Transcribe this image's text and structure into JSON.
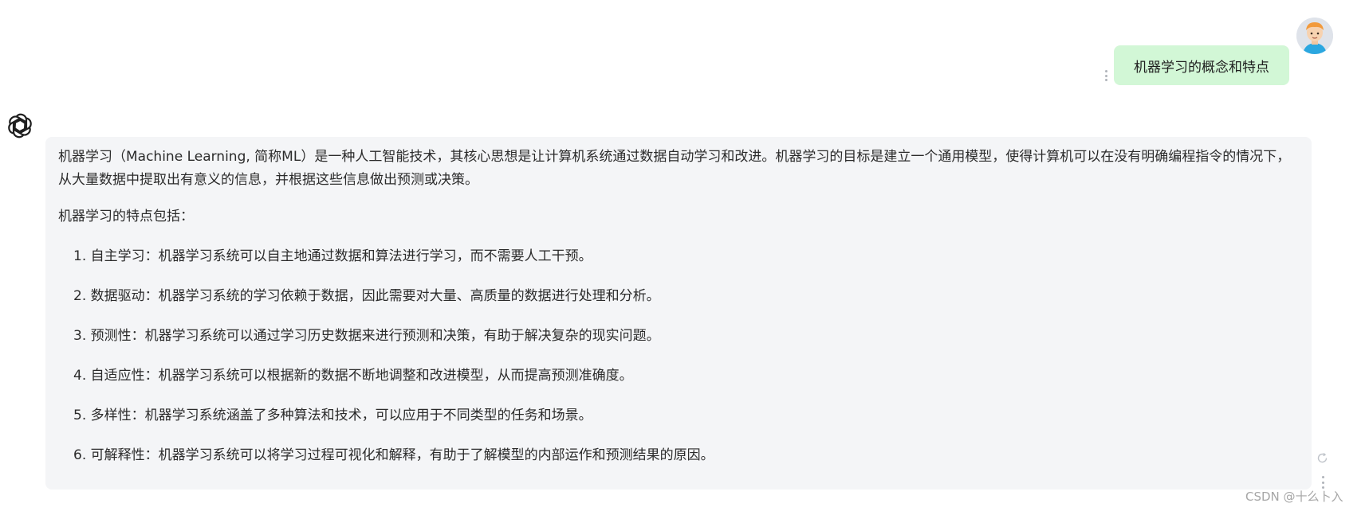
{
  "user_message": {
    "text": "机器学习的概念和特点",
    "avatar_icon": "user-avatar-cartoon"
  },
  "assistant": {
    "logo_icon": "openai-logo-icon",
    "intro": "机器学习（Machine Learning, 简称ML）是一种人工智能技术，其核心思想是让计算机系统通过数据自动学习和改进。机器学习的目标是建立一个通用模型，使得计算机可以在没有明确编程指令的情况下，从大量数据中提取出有意义的信息，并根据这些信息做出预测或决策。",
    "features_heading": "机器学习的特点包括：",
    "features": [
      "1. 自主学习：机器学习系统可以自主地通过数据和算法进行学习，而不需要人工干预。",
      "2. 数据驱动：机器学习系统的学习依赖于数据，因此需要对大量、高质量的数据进行处理和分析。",
      "3. 预测性：机器学习系统可以通过学习历史数据来进行预测和决策，有助于解决复杂的现实问题。",
      "4. 自适应性：机器学习系统可以根据新的数据不断地调整和改进模型，从而提高预测准确度。",
      "5. 多样性：机器学习系统涵盖了多种算法和技术，可以应用于不同类型的任务和场景。",
      "6. 可解释性：机器学习系统可以将学习过程可视化和解释，有助于了解模型的内部运作和预测结果的原因。"
    ]
  },
  "watermark": "CSDN @十么卜入",
  "colors": {
    "user_bubble": "#d2f7d6",
    "assistant_panel": "#f4f5f7",
    "text": "#2b2b2b"
  }
}
